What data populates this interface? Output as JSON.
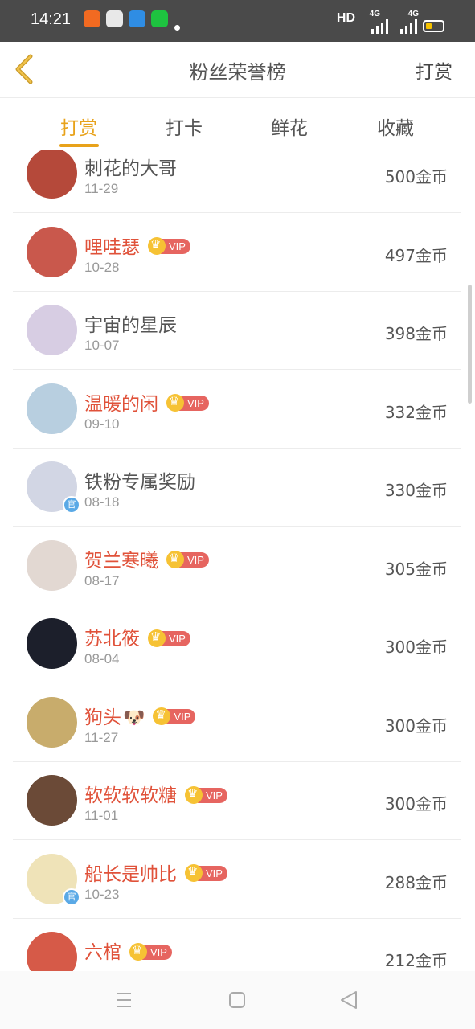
{
  "status_bar": {
    "time": "14:21",
    "network_label": "HD",
    "signal_1": "4G",
    "signal_2": "4G",
    "apps": [
      {
        "icon": "kuaishou-app-icon",
        "color": "#f26a21"
      },
      {
        "icon": "browser-app-icon",
        "color": "#e8e8e8"
      },
      {
        "icon": "circle-app-icon",
        "color": "#2f8de4"
      },
      {
        "icon": "iqiyi-app-icon",
        "color": "#1ec340"
      }
    ]
  },
  "header": {
    "back_icon": "chevron-left-icon",
    "title": "粉丝荣誉榜",
    "action_label": "打赏"
  },
  "tabs": [
    {
      "label": "打赏",
      "active": true
    },
    {
      "label": "打卡",
      "active": false
    },
    {
      "label": "鲜花",
      "active": false
    },
    {
      "label": "收藏",
      "active": false
    }
  ],
  "vip_label": "VIP",
  "fans": [
    {
      "name": "刺花的大哥",
      "date": "11-29",
      "amount": "500金币",
      "vip": false,
      "avatar_color": "#b5493a"
    },
    {
      "name": "哩哇瑟",
      "date": "10-28",
      "amount": "497金币",
      "vip": true,
      "avatar_color": "#c9584c"
    },
    {
      "name": "宇宙的星辰",
      "date": "10-07",
      "amount": "398金币",
      "vip": false,
      "avatar_color": "#d7cde3"
    },
    {
      "name": "温暖的闲",
      "date": "09-10",
      "amount": "332金币",
      "vip": true,
      "avatar_color": "#b8cfe0"
    },
    {
      "name": "铁粉专属奖励",
      "date": "08-18",
      "amount": "330金币",
      "vip": false,
      "avatar_color": "#d2d6e4",
      "badge": "官"
    },
    {
      "name": "贺兰寒曦",
      "date": "08-17",
      "amount": "305金币",
      "vip": true,
      "avatar_color": "#e2d8d2"
    },
    {
      "name": "苏北筱",
      "date": "08-04",
      "amount": "300金币",
      "vip": true,
      "avatar_color": "#1c1f2b"
    },
    {
      "name": "狗头",
      "date": "11-27",
      "amount": "300金币",
      "vip": true,
      "avatar_color": "#c8ac6c",
      "emoji": "🐶"
    },
    {
      "name": "软软软软糖",
      "date": "11-01",
      "amount": "300金币",
      "vip": true,
      "avatar_color": "#6b4a37"
    },
    {
      "name": "船长是帅比",
      "date": "10-23",
      "amount": "288金币",
      "vip": true,
      "avatar_color": "#efe3b8",
      "badge": "官"
    },
    {
      "name": "六棺",
      "date": "",
      "amount": "212金币",
      "vip": true,
      "avatar_color": "#d65a48"
    }
  ],
  "navbar": {
    "menu_icon": "menu-icon",
    "home_icon": "home-square-icon",
    "back_icon": "back-triangle-icon"
  }
}
